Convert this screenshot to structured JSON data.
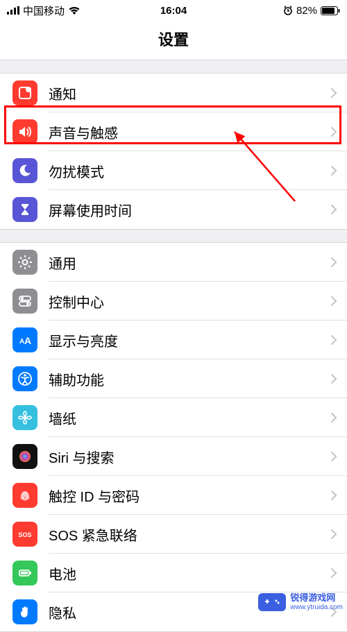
{
  "status": {
    "carrier": "中国移动",
    "time": "16:04",
    "battery_pct": "82%"
  },
  "title": "设置",
  "groups": [
    {
      "rows": [
        {
          "id": "notifications",
          "label": "通知",
          "icon": "notifications-icon",
          "bg": "#ff3b30"
        },
        {
          "id": "sounds",
          "label": "声音与触感",
          "icon": "sounds-icon",
          "bg": "#ff3b30",
          "highlighted": true
        },
        {
          "id": "dnd",
          "label": "勿扰模式",
          "icon": "moon-icon",
          "bg": "#5856d6"
        },
        {
          "id": "screentime",
          "label": "屏幕使用时间",
          "icon": "hourglass-icon",
          "bg": "#5856d6"
        }
      ]
    },
    {
      "rows": [
        {
          "id": "general",
          "label": "通用",
          "icon": "gear-icon",
          "bg": "#8e8e93"
        },
        {
          "id": "controlcenter",
          "label": "控制中心",
          "icon": "switches-icon",
          "bg": "#8e8e93"
        },
        {
          "id": "display",
          "label": "显示与亮度",
          "icon": "textsize-icon",
          "bg": "#007aff"
        },
        {
          "id": "accessibility",
          "label": "辅助功能",
          "icon": "accessibility-icon",
          "bg": "#007aff"
        },
        {
          "id": "wallpaper",
          "label": "墙纸",
          "icon": "flower-icon",
          "bg": "#37bye0"
        },
        {
          "id": "siri",
          "label": "Siri 与搜索",
          "icon": "siri-icon",
          "bg": "#111"
        },
        {
          "id": "touchid",
          "label": "触控 ID 与密码",
          "icon": "fingerprint-icon",
          "bg": "#ff3b30"
        },
        {
          "id": "sos",
          "label": "SOS 紧急联络",
          "icon": "sos-icon",
          "bg": "#ff3b30"
        },
        {
          "id": "battery",
          "label": "电池",
          "icon": "battery-icon",
          "bg": "#34c759"
        },
        {
          "id": "privacy",
          "label": "隐私",
          "icon": "hand-icon",
          "bg": "#007aff"
        }
      ]
    }
  ],
  "watermark": {
    "brand": "锐得游戏网",
    "url": "www.ytruida.com"
  }
}
